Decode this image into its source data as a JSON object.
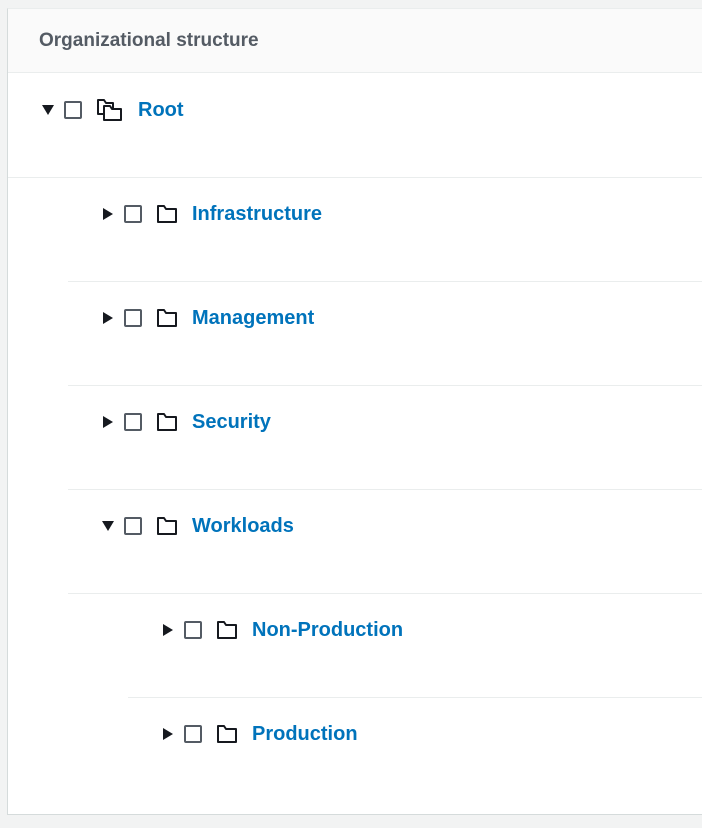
{
  "panel": {
    "title": "Organizational structure"
  },
  "tree": {
    "root": {
      "label": "Root",
      "expanded": true,
      "icon": "folder-stack-icon"
    },
    "children": [
      {
        "label": "Infrastructure",
        "expanded": false,
        "icon": "folder-icon"
      },
      {
        "label": "Management",
        "expanded": false,
        "icon": "folder-icon"
      },
      {
        "label": "Security",
        "expanded": false,
        "icon": "folder-icon"
      },
      {
        "label": "Workloads",
        "expanded": true,
        "icon": "folder-icon",
        "children": [
          {
            "label": "Non-Production",
            "expanded": false,
            "icon": "folder-icon"
          },
          {
            "label": "Production",
            "expanded": false,
            "icon": "folder-icon"
          }
        ]
      }
    ]
  },
  "colors": {
    "link": "#0073bb",
    "text": "#545b64",
    "icon": "#16191f",
    "divider": "#eaeded"
  }
}
